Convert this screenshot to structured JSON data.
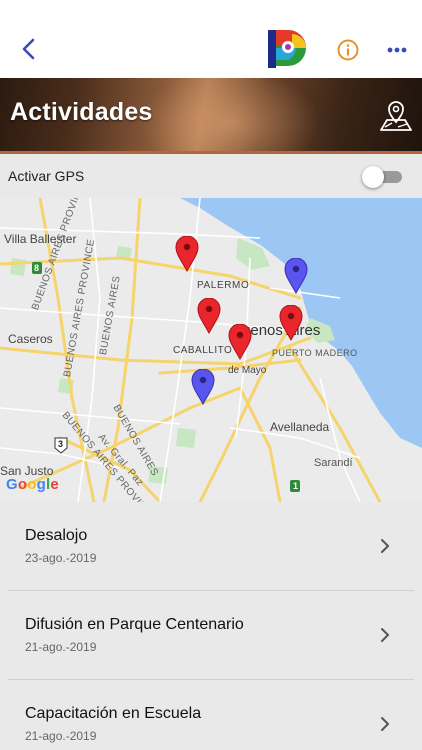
{
  "navbar": {
    "back_icon": "chevron-left-icon",
    "logo_icon": "app-logo-icon",
    "info_icon": "info-circle-icon",
    "more_icon": "more-horizontal-icon",
    "accent_blue": "#3a4bb5",
    "accent_orange": "#e8932a"
  },
  "banner": {
    "title": "Actividades",
    "map_icon": "map-pin-icon"
  },
  "gps": {
    "label": "Activar GPS",
    "enabled": false
  },
  "map": {
    "labels": {
      "villa_ballester": "Villa Ballester",
      "palermo": "PALERMO",
      "buenos_aires": "Buenos Aires",
      "caseros": "Caseros",
      "caballito": "CABALLITO",
      "puerto_madero": "PUERTO MADERO",
      "de_mayo": "de Mayo",
      "avellaneda": "Avellaneda",
      "sarandi": "Sarandí",
      "san_justo": "San Justo",
      "bap1": "BUENOS AIRES PROVINCE",
      "bap2": "BUENOS AIRES",
      "bap3": "BUENOS AIRES PROVINCE",
      "bap4": "BUENOS AIRES",
      "bap5": "BUENOS AIRES PROVINCE",
      "gral_paz": "Av. Gral. Paz",
      "route8": "8",
      "route3": "3",
      "route1": "1",
      "google": "Google"
    },
    "markers": [
      {
        "color": "#e8262b",
        "kind": "red"
      },
      {
        "color": "#5b55f0",
        "kind": "blue"
      },
      {
        "color": "#e8262b",
        "kind": "red"
      },
      {
        "color": "#e8262b",
        "kind": "red"
      },
      {
        "color": "#e8262b",
        "kind": "red"
      },
      {
        "color": "#5b55f0",
        "kind": "blue"
      }
    ]
  },
  "activities": [
    {
      "title": "Desalojo",
      "date": "23-ago.-2019"
    },
    {
      "title": "Difusión en Parque Centenario",
      "date": "21-ago.-2019"
    },
    {
      "title": "Capacitación en Escuela",
      "date": "21-ago.-2019"
    }
  ]
}
